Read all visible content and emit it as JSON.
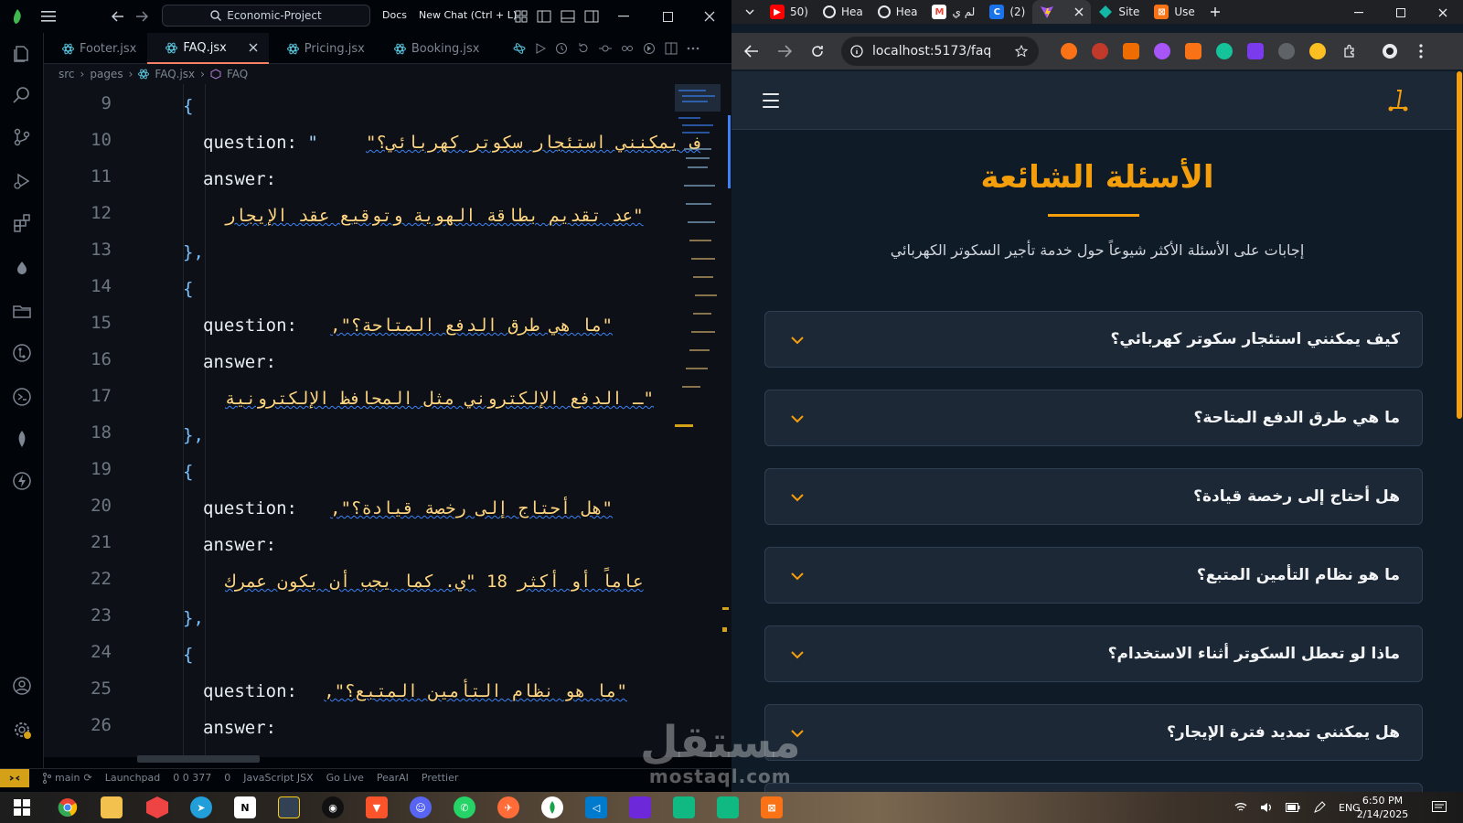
{
  "vscode": {
    "search_box": "Economic-Project",
    "docs_label": "Docs",
    "new_chat_label": "New Chat (Ctrl + L)",
    "tabs": [
      {
        "label": "Footer.jsx",
        "active": false
      },
      {
        "label": "FAQ.jsx",
        "active": true
      },
      {
        "label": "Pricing.jsx",
        "active": false
      },
      {
        "label": "Booking.jsx",
        "active": false
      }
    ],
    "breadcrumb": {
      "src": "src",
      "pages": "pages",
      "file": "FAQ.jsx",
      "symbol": "FAQ"
    },
    "line_numbers": [
      "9",
      "10",
      "11",
      "12",
      "13",
      "14",
      "15",
      "16",
      "17",
      "18",
      "19",
      "20",
      "21",
      "22",
      "23",
      "24",
      "25",
      "26"
    ],
    "code": {
      "l9": "{",
      "l10_key": "question:",
      "l10_val": "ف يمكنني استئجار سكوتر كهربائي؟\"",
      "l10_q": "\"",
      "l11": "answer:",
      "l12": "\"عد تقديم بطاقة الهوية وتوقيع عقد الإيجار",
      "l13": "},",
      "l14": "{",
      "l15_key": "question:",
      "l15_val": "\"ما هي طرق الدفع المتاحة؟\",",
      "l16": "answer:",
      "l17": "\"ـ الدفع الإلكتروني مثل المحافظ الإلكترونية",
      "l18": "},",
      "l19": "{",
      "l20_key": "question:",
      "l20_val": "\"هل أحتاج إلى رخصة قيادة؟\",",
      "l21": "answer:",
      "l22_a": "\"ي. كما يجب أن يكون عمرك",
      "l22_num": "18",
      "l22_b": "عاماً أو أكثر",
      "l23": "},",
      "l24": "{",
      "l25_key": "question:",
      "l25_val": "\"ما هو نظام التأمين المتبع؟\",",
      "l26": "answer:"
    },
    "status": {
      "branch": "main",
      "launchpad": "Launchpad",
      "problems": "0  0  377",
      "ports": "0",
      "language": "JavaScript JSX",
      "golive": "Go Live",
      "pearai": "PearAI",
      "prettier": "Prettier"
    }
  },
  "chrome": {
    "tabs": [
      {
        "label": "50)",
        "icon": "youtube"
      },
      {
        "label": "Hea",
        "icon": "openai"
      },
      {
        "label": "Hea",
        "icon": "openai"
      },
      {
        "label": "لم ي",
        "icon": "gmail"
      },
      {
        "label": "(2)",
        "icon": "app-blue"
      },
      {
        "label": "",
        "icon": "vite",
        "active": true
      },
      {
        "label": "Site",
        "icon": "diamond"
      },
      {
        "label": "Use",
        "icon": "app-orange"
      }
    ],
    "url": "localhost:5173/faq"
  },
  "site": {
    "title": "الأسئلة الشائعة",
    "subtitle": "إجابات على الأسئلة الأكثر شيوعاً حول خدمة تأجير السكوتر الكهربائي",
    "faqs": [
      "كيف يمكنني استئجار سكوتر كهربائي؟",
      "ما هي طرق الدفع المتاحة؟",
      "هل أحتاج إلى رخصة قيادة؟",
      "ما هو نظام التأمين المتبع؟",
      "ماذا لو تعطل السكوتر أثناء الاستخدام؟",
      "هل يمكنني تمديد فترة الإيجار؟"
    ],
    "accent": "#f59e0b"
  },
  "watermark": {
    "arabic": "مستقل",
    "latin": "mostaql.com"
  },
  "taskbar": {
    "lang": "ENG",
    "time": "6:50 PM",
    "date": "2/14/2025"
  }
}
